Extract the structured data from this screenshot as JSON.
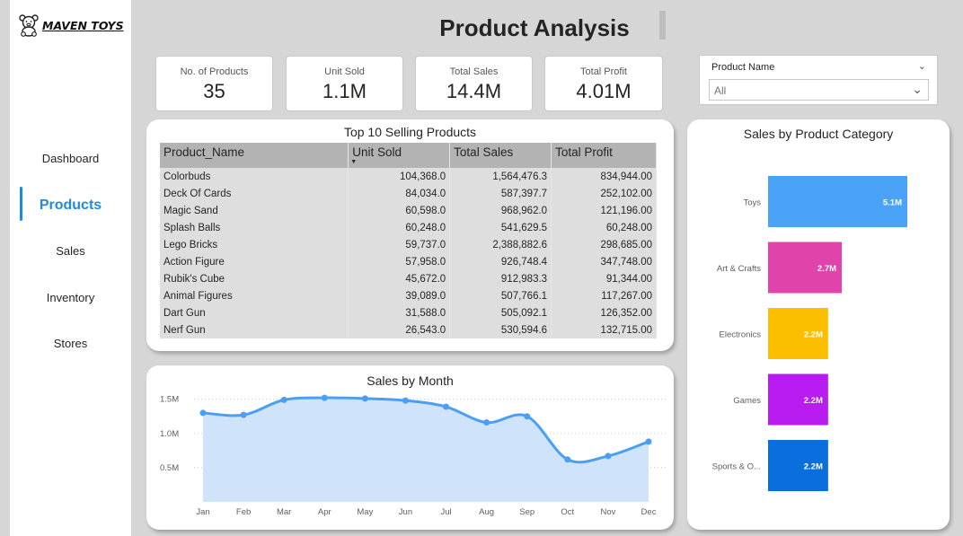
{
  "logo": {
    "text": "MAVEN TOYS",
    "icon": "teddy-bear-icon"
  },
  "nav": {
    "items": [
      {
        "label": "Dashboard",
        "active": false
      },
      {
        "label": "Products",
        "active": true
      },
      {
        "label": "Sales",
        "active": false
      },
      {
        "label": "Inventory",
        "active": false
      },
      {
        "label": "Stores",
        "active": false
      }
    ]
  },
  "page_title": "Product Analysis",
  "kpis": [
    {
      "label": "No. of Products",
      "value": "35"
    },
    {
      "label": "Unit Sold",
      "value": "1.1M"
    },
    {
      "label": "Total Sales",
      "value": "14.4M"
    },
    {
      "label": "Total Profit",
      "value": "4.01M"
    }
  ],
  "slicer": {
    "title": "Product Name",
    "value": "All"
  },
  "top_products": {
    "title": "Top 10 Selling Products",
    "columns": [
      "Product_Name",
      "Unit Sold",
      "Total Sales",
      "Total Profit"
    ],
    "rows": [
      [
        "Colorbuds",
        "104,368.0",
        "1,564,476.3",
        "834,944.00"
      ],
      [
        "Deck Of Cards",
        "84,034.0",
        "587,397.7",
        "252,102.00"
      ],
      [
        "Magic Sand",
        "60,598.0",
        "968,962.0",
        "121,196.00"
      ],
      [
        "Splash Balls",
        "60,248.0",
        "541,629.5",
        "60,248.00"
      ],
      [
        "Lego Bricks",
        "59,737.0",
        "2,388,882.6",
        "298,685.00"
      ],
      [
        "Action Figure",
        "57,958.0",
        "926,748.4",
        "347,748.00"
      ],
      [
        "Rubik's Cube",
        "45,672.0",
        "912,983.3",
        "91,344.00"
      ],
      [
        "Animal Figures",
        "39,089.0",
        "507,766.1",
        "117,267.00"
      ],
      [
        "Dart Gun",
        "31,588.0",
        "505,092.1",
        "126,352.00"
      ],
      [
        "Nerf Gun",
        "26,543.0",
        "530,594.6",
        "132,715.00"
      ]
    ]
  },
  "chart_data": [
    {
      "type": "area",
      "title": "Sales by Month",
      "categories": [
        "Jan",
        "Feb",
        "Mar",
        "Apr",
        "May",
        "Jun",
        "Jul",
        "Aug",
        "Sep",
        "Oct",
        "Nov",
        "Dec"
      ],
      "values": [
        1.3,
        1.27,
        1.49,
        1.52,
        1.51,
        1.48,
        1.39,
        1.16,
        1.25,
        0.62,
        0.67,
        0.88
      ],
      "y_ticks": [
        "0.5M",
        "1.0M",
        "1.5M"
      ],
      "y_tick_values": [
        0.5,
        1.0,
        1.5
      ],
      "ylim": [
        0.0,
        1.6
      ],
      "color": "#4a9ff5",
      "fill": "#cfe4fb"
    },
    {
      "type": "bar",
      "orientation": "horizontal",
      "title": "Sales by Product Category",
      "categories": [
        "Toys",
        "Art & Crafts",
        "Electronics",
        "Games",
        "Sports & O..."
      ],
      "values": [
        5.1,
        2.7,
        2.2,
        2.2,
        2.2
      ],
      "labels": [
        "5.1M",
        "2.7M",
        "2.2M",
        "2.2M",
        "2.2M"
      ],
      "colors": [
        "#4aa3f7",
        "#e044aa",
        "#fcbf00",
        "#b81cf0",
        "#0a6fdc"
      ]
    }
  ]
}
